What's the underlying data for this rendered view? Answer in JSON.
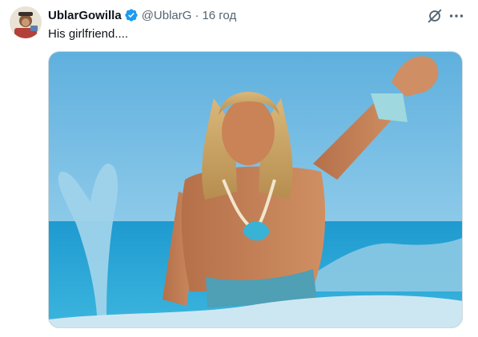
{
  "tweet": {
    "display_name": "UblarGowilla",
    "handle": "@UblarG",
    "separator": "·",
    "time": "16 год",
    "text": "His girlfriend....",
    "verified": true
  },
  "icons": {
    "verified": "verified-badge-icon",
    "grok": "grok-icon",
    "more": "more-options-icon"
  },
  "colors": {
    "verified": "#1d9bf0",
    "secondary_text": "#536471",
    "primary_text": "#0f1419",
    "border": "#cfd9de"
  }
}
